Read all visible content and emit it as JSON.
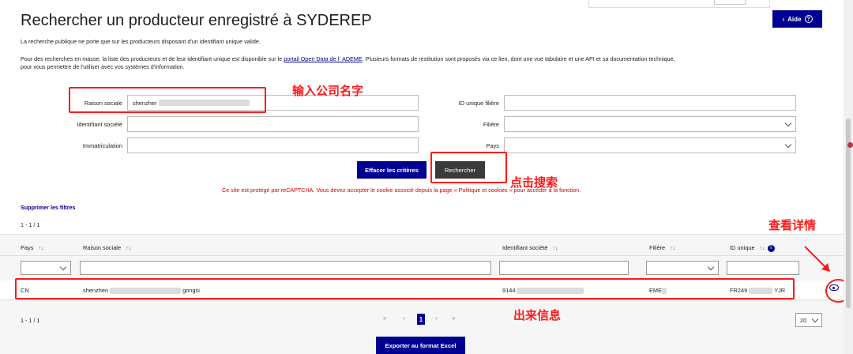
{
  "page": {
    "title": "Rechercher un producteur enregistré à SYDEREP",
    "aide_label": "Aide",
    "intro_1": "La recherche publique ne porte que sur les producteurs disposant d'un identifiant unique valide.",
    "intro_2a": "Pour des recherches en masse, la liste des producteurs et de leur identifiant unique est disponible sur le ",
    "intro_2_link": "portail Open Data de l´ ADEME",
    "intro_2b": ". Plusieurs formats de restitution sont proposés via ce lien, dont une vue tabulaire et une API et sa documentation technique,",
    "intro_3": "pour vous permettre de l'utiliser avec vos systèmes d'information."
  },
  "form": {
    "raison_sociale_label": "Raison sociale",
    "raison_sociale_value": "shenzher",
    "identifiant_societe_label": "Identifiant société",
    "immatriculation_label": "Immatriculation",
    "id_unique_filiere_label": "ID unique filière",
    "filiere_label": "Filière",
    "pays_label": "Pays",
    "clear_label": "Effacer les critères",
    "search_label": "Rechercher",
    "captcha_text": "Ce site est protégé par reCAPTCHA. Vous devez accepter le cookie associé depuis la page « Politique et cookies » pour accéder à la fonction."
  },
  "results": {
    "clear_filters": "Supprimer les filtres",
    "count_top": "1 - 1 / 1",
    "count_bottom": "1 - 1 / 1",
    "columns": {
      "pays": "Pays",
      "raison_sociale": "Raison sociale",
      "identifiant_societe": "Identifiant société",
      "filiere": "Filière",
      "id_unique": "ID unique"
    },
    "row": {
      "pays": "CN",
      "raison_sociale_a": "shenzhen",
      "raison_sociale_b": "gongsi",
      "identifiant_societe": "9144",
      "filiere": "EME",
      "id_unique_a": "FR249",
      "id_unique_b": "YJR"
    },
    "pager": {
      "first": "«",
      "prev": "‹",
      "current": "1",
      "next": "›",
      "last": "»"
    },
    "per_page": "20",
    "export_label": "Exporter au format Excel"
  },
  "annotations": {
    "company_name": "输入公司名字",
    "click_search": "点击搜索",
    "view_details": "查看详情",
    "result_info": "出来信息"
  },
  "colors": {
    "primary": "#000091",
    "annotation": "#ff1a1a",
    "error": "#ce0500"
  }
}
